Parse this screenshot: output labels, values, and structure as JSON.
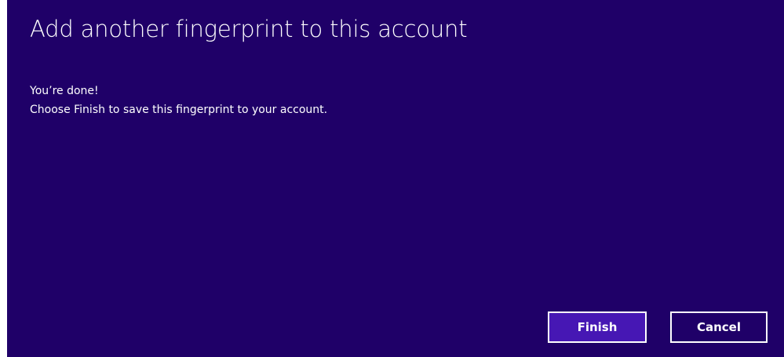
{
  "dialog": {
    "title": "Add another fingerprint to this account",
    "message_line1": "You’re done!",
    "message_line2": "Choose Finish to save this fingerprint to your account.",
    "buttons": {
      "finish_label": "Finish",
      "cancel_label": "Cancel"
    }
  },
  "colors": {
    "background": "#1f0068",
    "accent_button": "#4617b4",
    "text": "#ffffff"
  }
}
